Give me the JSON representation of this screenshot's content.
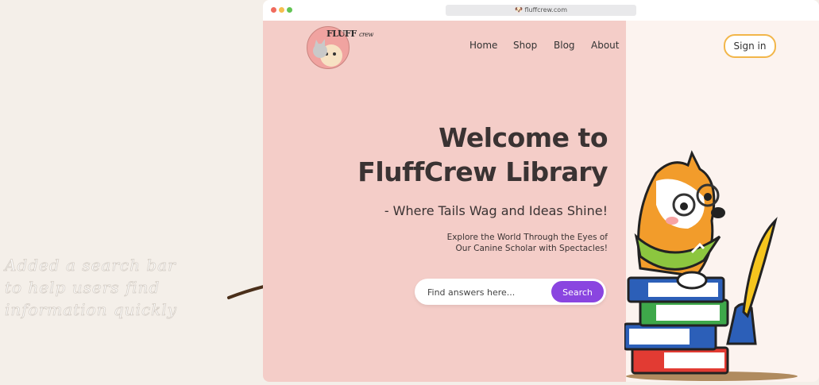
{
  "annotation": {
    "lines": [
      "Added a search bar",
      "to help users find",
      "information quickly"
    ]
  },
  "browser": {
    "url": "fluffcrew.com"
  },
  "site": {
    "logo_text": "FLUFF",
    "logo_subtext": "crew"
  },
  "nav": {
    "items": [
      {
        "label": "Home"
      },
      {
        "label": "Shop"
      },
      {
        "label": "Blog"
      },
      {
        "label": "About"
      }
    ],
    "signin_label": "Sign in"
  },
  "hero": {
    "title_line1": "Welcome to",
    "title_line2": "FluffCrew Library",
    "subtitle": "- Where Tails Wag and Ideas Shine!",
    "desc_line1": "Explore the World Through the Eyes of",
    "desc_line2": "Our Canine Scholar with Spectacles!"
  },
  "search": {
    "placeholder": "Find answers here...",
    "button_label": "Search"
  },
  "colors": {
    "hero_bg": "#f4cdc8",
    "accent_purple": "#8a45e0",
    "signin_border": "#f2b64a"
  }
}
